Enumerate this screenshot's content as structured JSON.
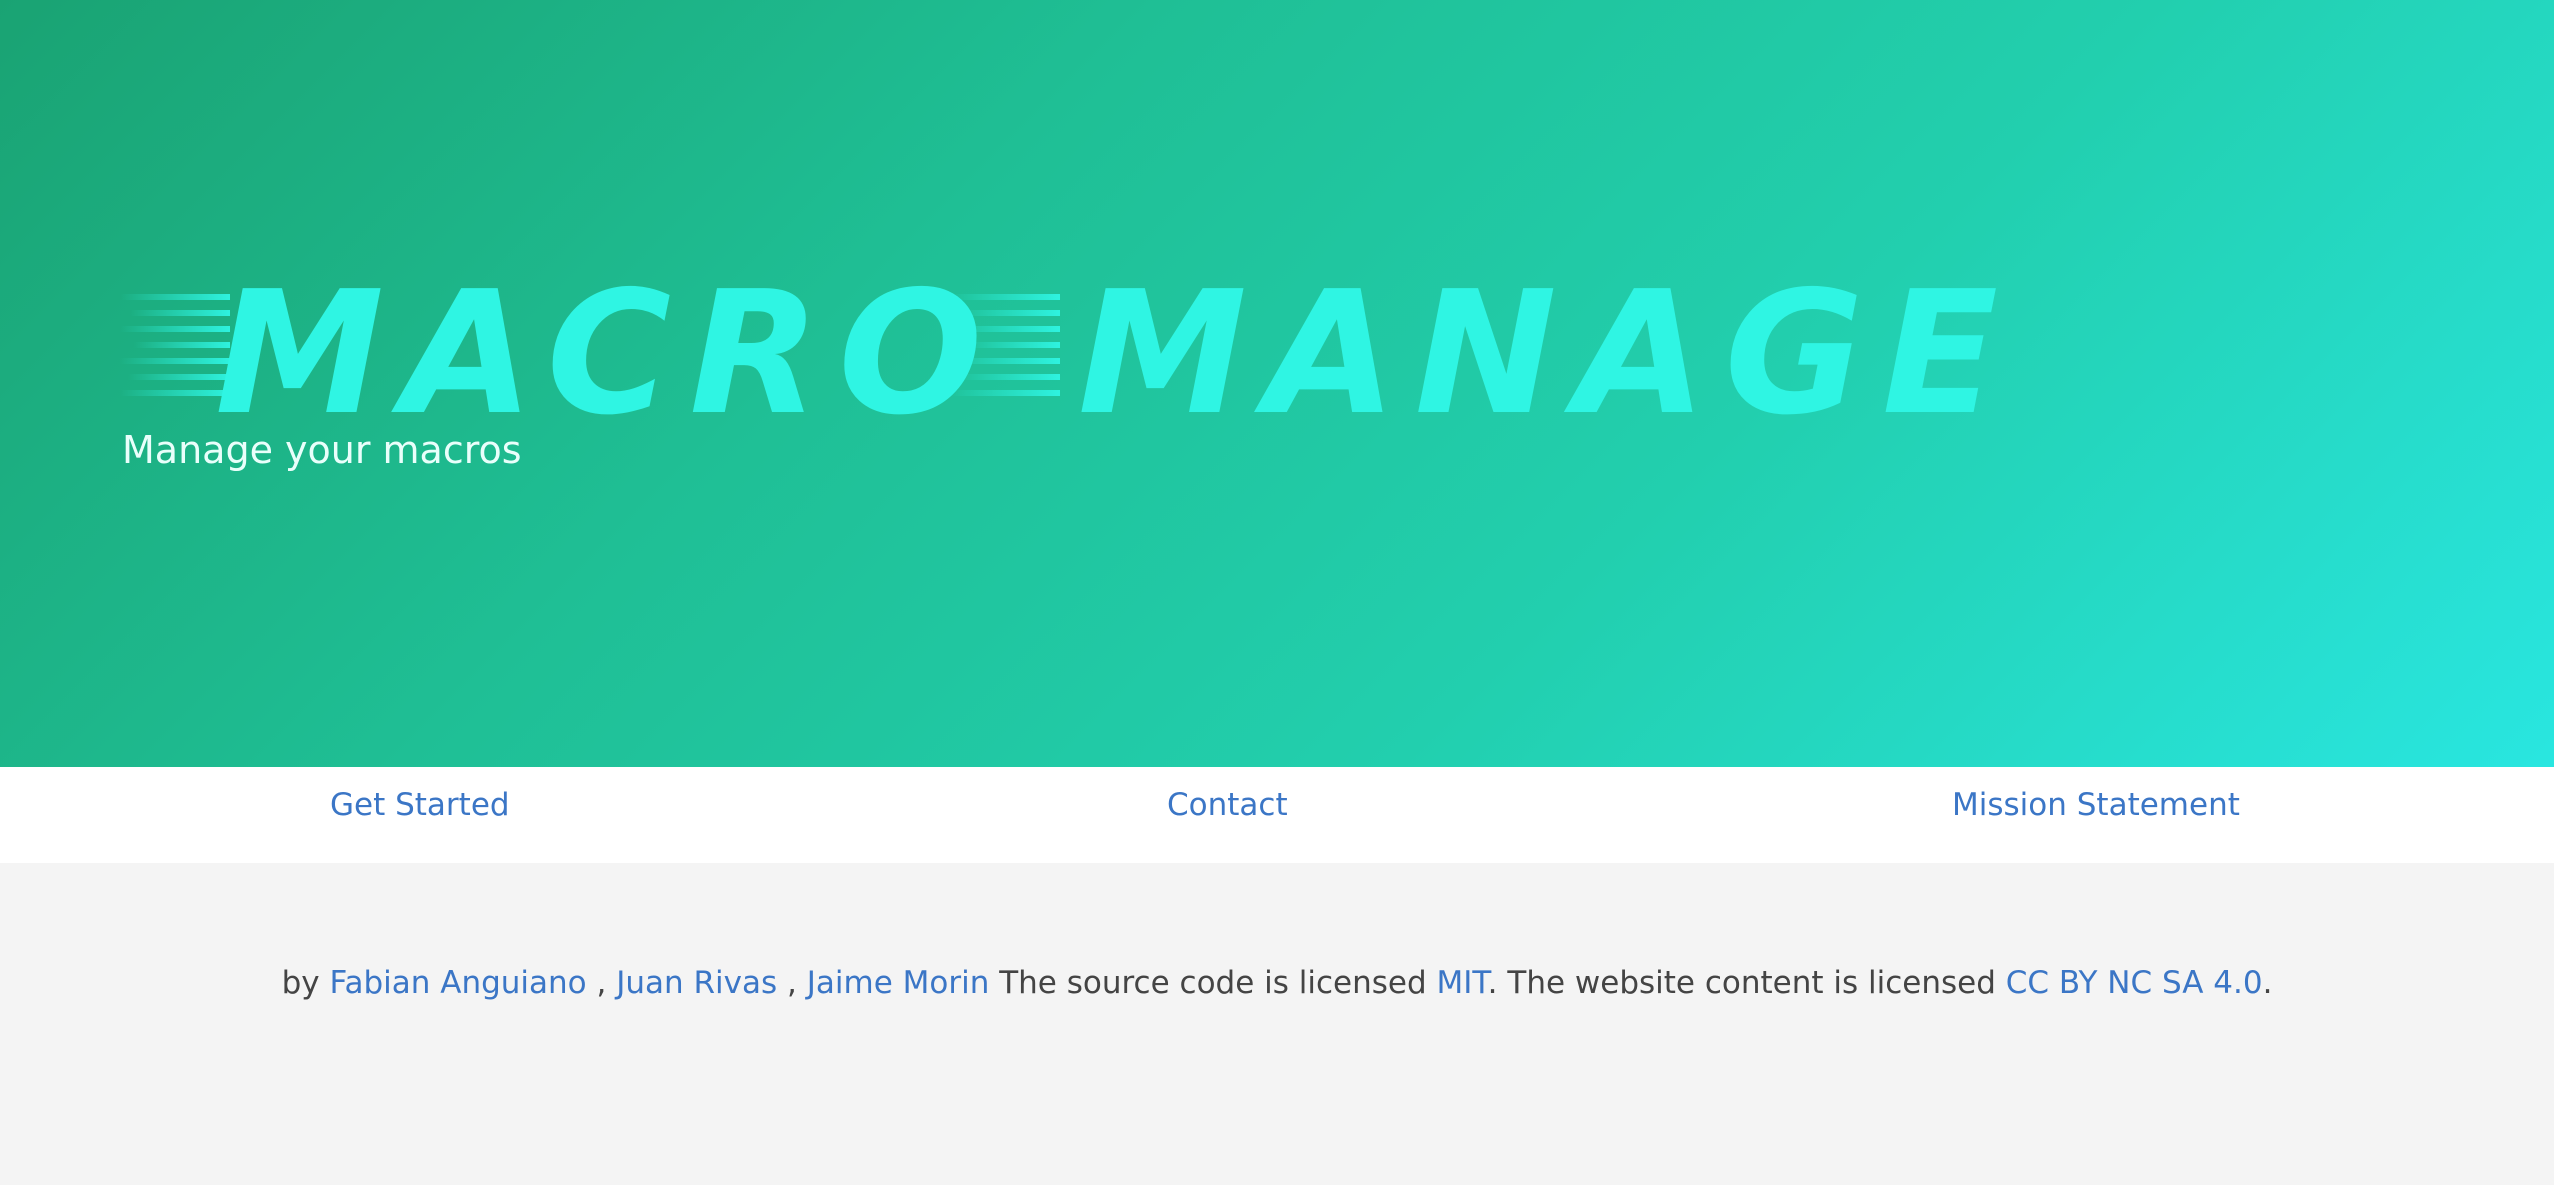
{
  "hero": {
    "logo_text": "MACRO MANAGE",
    "subtitle": "Manage your macros"
  },
  "nav": {
    "links": [
      "Get Started",
      "Contact",
      "Mission Statement"
    ]
  },
  "footer": {
    "by": "by",
    "authors": [
      "Fabian Anguiano",
      "Juan Rivas",
      "Jaime Morin"
    ],
    "separator": ",",
    "source_text": "The source code is licensed",
    "source_license": "MIT",
    "content_text": ". The website content is licensed",
    "content_license": "CC BY NC SA 4.0",
    "end": "."
  },
  "colors": {
    "hero_gradient_start": "#1aa373",
    "hero_gradient_end": "#29e6e0",
    "logo": "#2ff5e3",
    "link": "#3b76c6",
    "footer_background": "#f4f4f4"
  }
}
